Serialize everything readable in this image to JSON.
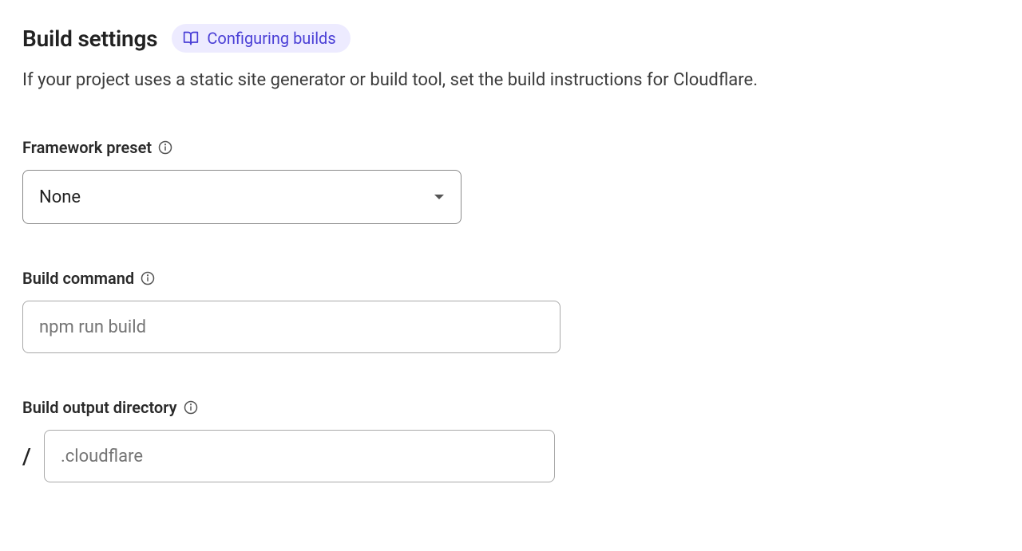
{
  "header": {
    "title": "Build settings",
    "docs_link_label": "Configuring builds"
  },
  "description": "If your project uses a static site generator or build tool, set the build instructions for Cloudflare.",
  "fields": {
    "framework_preset": {
      "label": "Framework preset",
      "value": "None"
    },
    "build_command": {
      "label": "Build command",
      "placeholder": "npm run build",
      "value": ""
    },
    "build_output_directory": {
      "label": "Build output directory",
      "prefix": "/",
      "placeholder": ".cloudflare",
      "value": ""
    }
  }
}
